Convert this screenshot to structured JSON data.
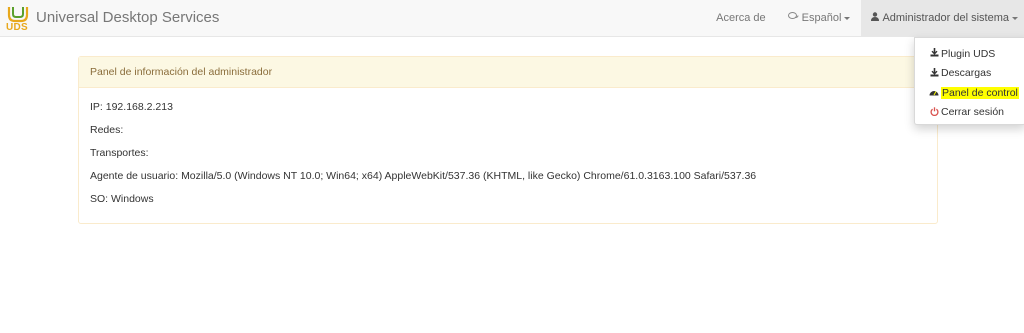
{
  "app": {
    "logo_text": "UDS",
    "title": "Universal Desktop Services"
  },
  "nav": {
    "about": "Acerca de",
    "language": "Español",
    "user": "Administrador del sistema"
  },
  "panel": {
    "heading": "Panel de información del administrador",
    "ip": "IP: 192.168.2.213",
    "networks": "Redes:",
    "transports": "Transportes:",
    "user_agent": "Agente de usuario: Mozilla/5.0 (Windows NT 10.0; Win64; x64) AppleWebKit/537.36 (KHTML, like Gecko) Chrome/61.0.3163.100 Safari/537.36",
    "os": "SO: Windows"
  },
  "user_menu": {
    "items": [
      {
        "label": "Plugin UDS",
        "icon": "download-icon"
      },
      {
        "label": "Descargas",
        "icon": "download-icon"
      },
      {
        "label": "Panel de control",
        "icon": "dashboard-icon",
        "highlighted": true
      },
      {
        "label": "Cerrar sesión",
        "icon": "power-icon"
      }
    ]
  },
  "colors": {
    "navbar_bg": "#f8f8f8",
    "panel_heading_bg": "#fcf8e3",
    "panel_heading_text": "#8a6d3b",
    "panel_border": "#faebcc",
    "logout_icon": "#d9534f",
    "highlight": "#ffff00"
  }
}
